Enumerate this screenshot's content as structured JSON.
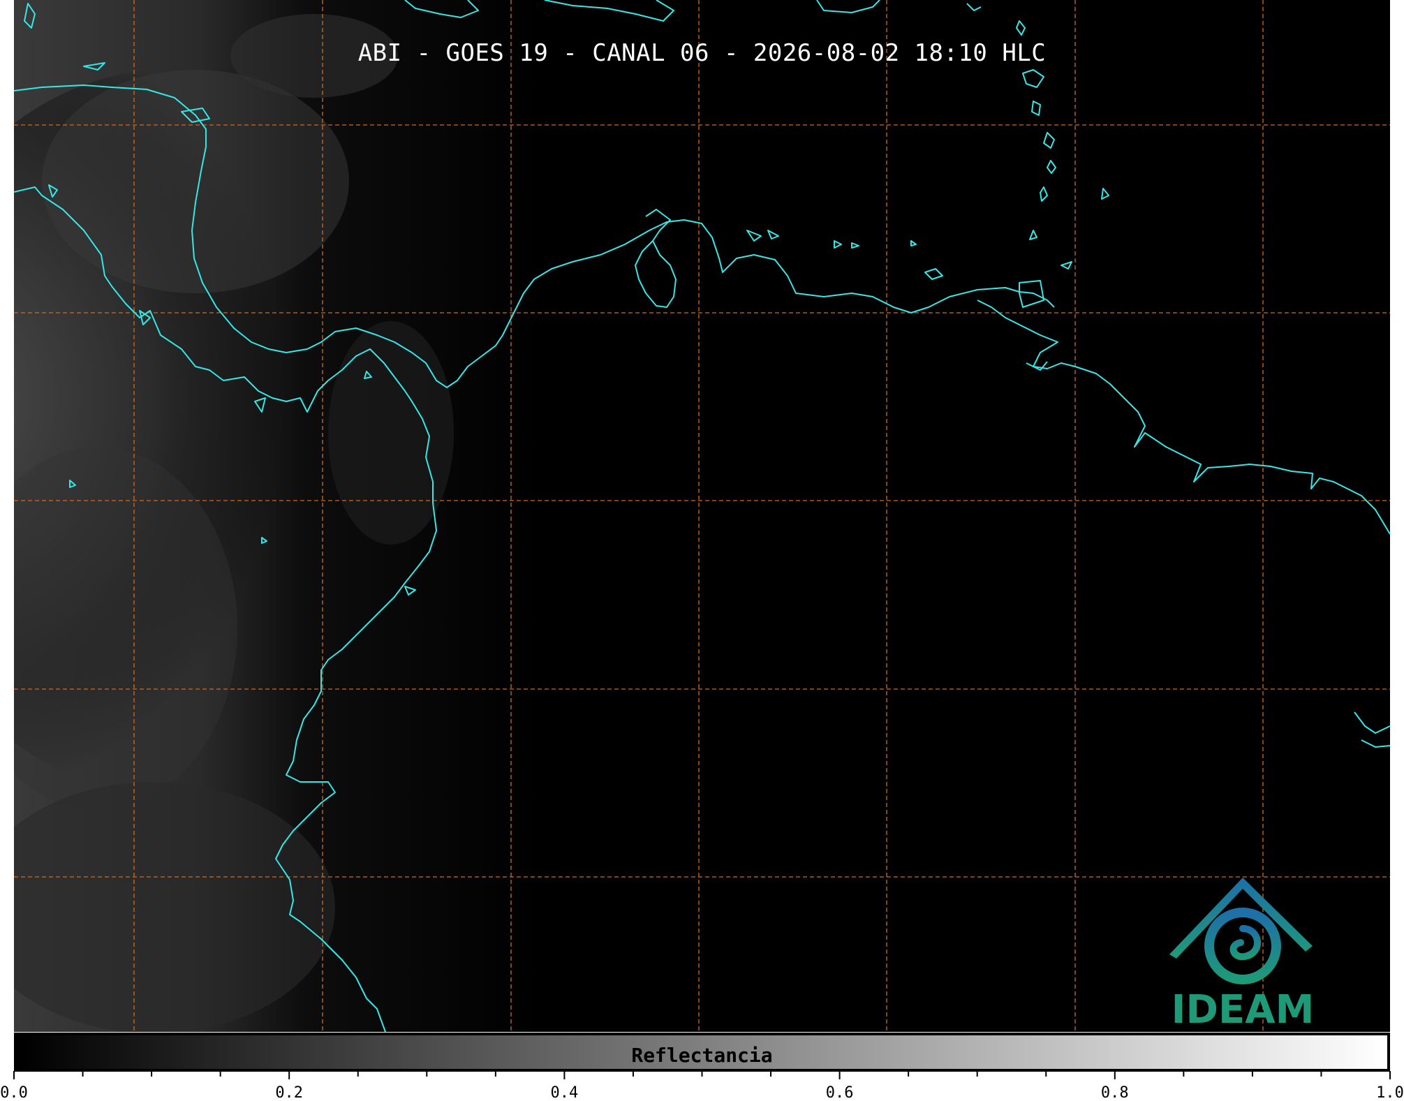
{
  "title": "ABI - GOES 19 - CANAL 06 - 2026-08-02 18:10 HLC",
  "logo_text": "IDEAM",
  "colors": {
    "background": "#000000",
    "coastline": "#34e8e8",
    "grid": "#d36a1c",
    "logo_blue": "#1d6fa8",
    "logo_green": "#1f9a78"
  },
  "colorbar": {
    "label": "Reflectancia",
    "min": 0.0,
    "max": 1.0,
    "colormap": "grayscale",
    "ticks": [
      "0.0",
      "0.2",
      "0.4",
      "0.6",
      "0.8",
      "1.0"
    ]
  }
}
